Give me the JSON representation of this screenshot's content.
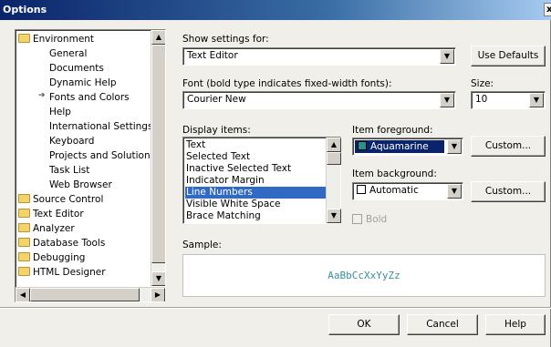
{
  "window": {
    "title": "Options",
    "close_label": "x"
  },
  "tree": {
    "items": [
      {
        "label": "Environment",
        "kind": "folder-open"
      },
      {
        "label": "General",
        "kind": "child"
      },
      {
        "label": "Documents",
        "kind": "child"
      },
      {
        "label": "Dynamic Help",
        "kind": "child"
      },
      {
        "label": "Fonts and Colors",
        "kind": "child-selected"
      },
      {
        "label": "Help",
        "kind": "child"
      },
      {
        "label": "International Settings",
        "kind": "child"
      },
      {
        "label": "Keyboard",
        "kind": "child"
      },
      {
        "label": "Projects and Solutions",
        "kind": "child"
      },
      {
        "label": "Task List",
        "kind": "child"
      },
      {
        "label": "Web Browser",
        "kind": "child"
      },
      {
        "label": "Source Control",
        "kind": "folder"
      },
      {
        "label": "Text Editor",
        "kind": "folder"
      },
      {
        "label": "Analyzer",
        "kind": "folder"
      },
      {
        "label": "Database Tools",
        "kind": "folder"
      },
      {
        "label": "Debugging",
        "kind": "folder"
      },
      {
        "label": "HTML Designer",
        "kind": "folder"
      }
    ]
  },
  "show_settings": {
    "label": "Show settings for:",
    "value": "Text Editor"
  },
  "use_defaults_label": "Use Defaults",
  "font": {
    "label": "Font (bold type indicates fixed-width fonts):",
    "value": "Courier New"
  },
  "size": {
    "label": "Size:",
    "value": "10"
  },
  "display_items": {
    "label": "Display items:",
    "items": [
      "Text",
      "Selected Text",
      "Inactive Selected Text",
      "Indicator Margin",
      "Line Numbers",
      "Visible White Space",
      "Brace Matching"
    ],
    "selected": "Line Numbers"
  },
  "item_foreground": {
    "label": "Item foreground:",
    "value": "Aquamarine",
    "color": "#2a8f8f"
  },
  "item_background": {
    "label": "Item background:",
    "value": "Automatic",
    "color": "#ffffff"
  },
  "custom_fg_label": "Custom...",
  "custom_bg_label": "Custom...",
  "bold_label": "Bold",
  "sample": {
    "label": "Sample:",
    "text": "AaBbCcXxYyZz"
  },
  "footer": {
    "ok": "OK",
    "cancel": "Cancel",
    "help": "Help"
  }
}
